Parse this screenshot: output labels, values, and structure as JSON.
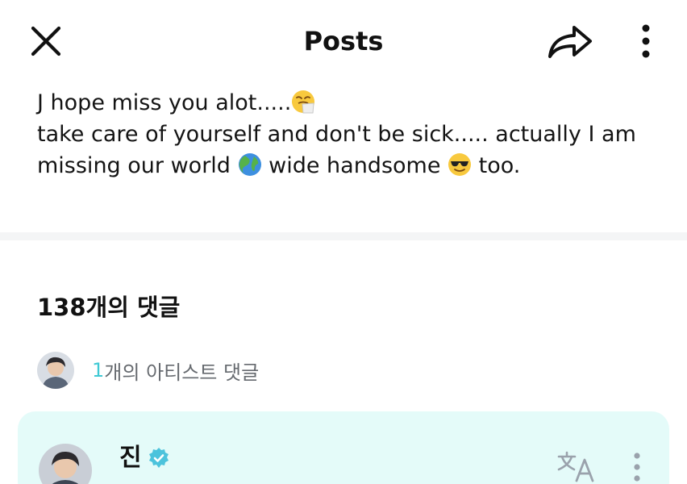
{
  "header": {
    "title": "Posts",
    "icons": [
      "close-icon",
      "share-icon",
      "more-vertical-icon"
    ]
  },
  "post": {
    "line1": "J hope miss you alot.....",
    "line2": "take care of yourself and don't be sick..... actually I am",
    "line3a": "missing our world",
    "line3b": "wide handsome",
    "line3c": "too.",
    "emojis": [
      "sneezing-face-emoji",
      "globe-emoji",
      "sunglasses-face-emoji"
    ]
  },
  "comments": {
    "heading": "138개의 댓글",
    "artist_count": "1",
    "artist_label": "개의 아티스트 댓글"
  },
  "comment_card": {
    "author": "진",
    "icons": [
      "verified-badge-icon",
      "translate-icon",
      "more-vertical-icon"
    ]
  },
  "colors": {
    "accent": "#3fc9d4",
    "card_background": "#e4fbf9",
    "verified": "#4cc3dc"
  }
}
